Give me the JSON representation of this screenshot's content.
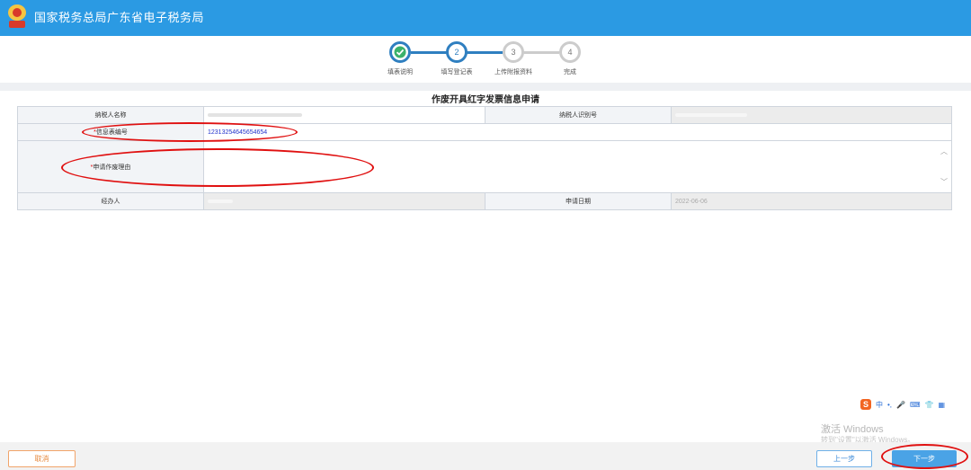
{
  "header": {
    "title": "国家税务总局广东省电子税务局",
    "emblem_icon": "tax-emblem-icon"
  },
  "steps": [
    {
      "number": "",
      "label": "填表说明",
      "state": "done"
    },
    {
      "number": "2",
      "label": "填写登记表",
      "state": "current"
    },
    {
      "number": "3",
      "label": "上传附报资料",
      "state": "pending"
    },
    {
      "number": "4",
      "label": "完成",
      "state": "pending"
    }
  ],
  "form": {
    "title": "作废开具红字发票信息申请",
    "taxpayer_name_label": "纳税人名称",
    "taxpayer_id_label": "纳税人识别号",
    "info_sheet_no_label": "信息表编号",
    "info_sheet_no_value": "12313254645654654",
    "reason_label": "申请作废理由",
    "handler_label": "经办人",
    "apply_date_label": "申请日期",
    "apply_date_value": "2022-06-06",
    "required_mark": "*"
  },
  "watermark": {
    "line1": "激活 Windows",
    "line2": "转到\"设置\"以激活 Windows。"
  },
  "buttons": {
    "cancel": "取消",
    "prev": "上一步",
    "next": "下一步"
  },
  "ime_toolbar": {
    "logo": "S",
    "items": [
      "中",
      "•,",
      "🎤",
      "⌨",
      "👕",
      "▦"
    ]
  },
  "colors": {
    "header_bg": "#2b9ae3",
    "step_active": "#2f7fc0",
    "step_pending": "#cccccc",
    "annotation": "#e01010"
  }
}
